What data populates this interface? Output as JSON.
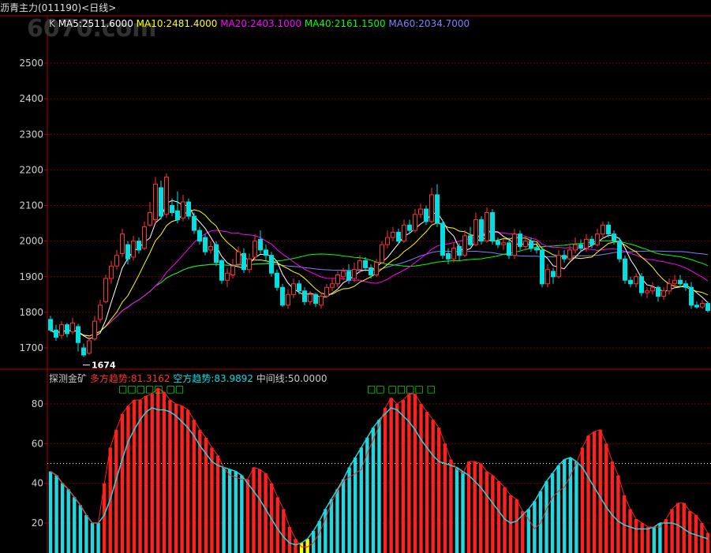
{
  "window": {
    "title": "沥青主力(011190)<日线>"
  },
  "watermark": {
    "text": "6070.com"
  },
  "price_panel": {
    "legend": [
      {
        "key": "k",
        "text": "K",
        "color": "#c8c8c8"
      },
      {
        "key": "ma5",
        "text": "MA5:2511.6000",
        "color": "#ffffff"
      },
      {
        "key": "ma10",
        "text": "MA10:2481.4000",
        "color": "#ffff00"
      },
      {
        "key": "ma20",
        "text": "MA20:2403.1000",
        "color": "#ff00ff"
      },
      {
        "key": "ma40",
        "text": "MA40:2161.1500",
        "color": "#00ff00"
      },
      {
        "key": "ma60",
        "text": "MA60:2034.7000",
        "color": "#8080ff"
      }
    ],
    "y_ticks": [
      "2500",
      "2400",
      "2300",
      "2200",
      "2100",
      "2000",
      "1900",
      "1800",
      "1700"
    ],
    "low_marker": "1674"
  },
  "indicator_panel": {
    "legend": [
      {
        "key": "name",
        "text": "探测金矿",
        "color": "#c8c8c8"
      },
      {
        "key": "bull",
        "text": "多方趋势:81.3162",
        "color": "#ff3030"
      },
      {
        "key": "bear",
        "text": "空方趋势:83.9892",
        "color": "#00e0e0"
      },
      {
        "key": "mid",
        "text": "中间线:50.0000",
        "color": "#c8c8c8"
      }
    ],
    "y_ticks": [
      "80",
      "60",
      "40",
      "20"
    ],
    "signals": [
      "□□□□□ □□",
      "□□ □□□□ □"
    ]
  },
  "colors": {
    "up": "#ff3232",
    "down": "#00e0e0",
    "grid": "#7a0000",
    "axis": "#b00000",
    "bull_bar": "#ff2020",
    "bear_bar": "#20d8e0",
    "yellow_bar": "#ffff00",
    "signal": "#00ff00"
  },
  "chart_data": [
    {
      "type": "candlestick",
      "title": "沥青主力(011190)<日线>",
      "ylim": [
        1660,
        2560
      ],
      "y_ticks": [
        2500,
        2400,
        2300,
        2200,
        2100,
        2000,
        1900,
        1800,
        1700
      ],
      "candles": [
        [
          1780,
          1750,
          1790,
          1745
        ],
        [
          1750,
          1730,
          1765,
          1720
        ],
        [
          1735,
          1765,
          1775,
          1725
        ],
        [
          1765,
          1740,
          1770,
          1730
        ],
        [
          1745,
          1770,
          1785,
          1738
        ],
        [
          1760,
          1715,
          1768,
          1690
        ],
        [
          1700,
          1680,
          1712,
          1674
        ],
        [
          1685,
          1720,
          1735,
          1680
        ],
        [
          1725,
          1775,
          1790,
          1720
        ],
        [
          1780,
          1820,
          1835,
          1770
        ],
        [
          1830,
          1895,
          1905,
          1825
        ],
        [
          1895,
          1930,
          1945,
          1880
        ],
        [
          1930,
          1960,
          1975,
          1920
        ],
        [
          1965,
          2020,
          2035,
          1955
        ],
        [
          1990,
          1950,
          2000,
          1935
        ],
        [
          1955,
          2000,
          2015,
          1945
        ],
        [
          2000,
          1975,
          2010,
          1965
        ],
        [
          1980,
          2040,
          2055,
          1975
        ],
        [
          2045,
          2080,
          2110,
          2040
        ],
        [
          2060,
          2160,
          2180,
          2050
        ],
        [
          2150,
          2070,
          2170,
          2060
        ],
        [
          2075,
          2180,
          2190,
          2065
        ],
        [
          2100,
          2080,
          2120,
          2070
        ],
        [
          2085,
          2060,
          2140,
          2050
        ],
        [
          2065,
          2110,
          2130,
          2055
        ],
        [
          2110,
          2070,
          2120,
          2060
        ],
        [
          2070,
          2030,
          2080,
          2020
        ],
        [
          2030,
          2000,
          2040,
          1990
        ],
        [
          2010,
          1970,
          2020,
          1960
        ],
        [
          1975,
          1985,
          2000,
          1965
        ],
        [
          1990,
          1940,
          2000,
          1930
        ],
        [
          1945,
          1890,
          1950,
          1880
        ],
        [
          1890,
          1910,
          1925,
          1870
        ],
        [
          1905,
          1930,
          1950,
          1895
        ],
        [
          1935,
          1970,
          1985,
          1925
        ],
        [
          1965,
          1920,
          1980,
          1910
        ],
        [
          1920,
          1950,
          1965,
          1910
        ],
        [
          1955,
          2000,
          2020,
          1945
        ],
        [
          2005,
          1975,
          2030,
          1965
        ],
        [
          1975,
          1960,
          1990,
          1945
        ],
        [
          1960,
          1910,
          1970,
          1900
        ],
        [
          1910,
          1870,
          1920,
          1860
        ],
        [
          1870,
          1820,
          1880,
          1815
        ],
        [
          1820,
          1850,
          1865,
          1810
        ],
        [
          1850,
          1880,
          1895,
          1840
        ],
        [
          1880,
          1860,
          1890,
          1850
        ],
        [
          1860,
          1830,
          1870,
          1820
        ],
        [
          1830,
          1850,
          1860,
          1820
        ],
        [
          1850,
          1825,
          1855,
          1815
        ],
        [
          1820,
          1845,
          1855,
          1810
        ],
        [
          1845,
          1870,
          1880,
          1840
        ],
        [
          1870,
          1880,
          1895,
          1860
        ],
        [
          1880,
          1905,
          1915,
          1870
        ],
        [
          1900,
          1915,
          1925,
          1890
        ],
        [
          1915,
          1890,
          1935,
          1880
        ],
        [
          1895,
          1920,
          1940,
          1885
        ],
        [
          1920,
          1945,
          1960,
          1910
        ],
        [
          1945,
          1925,
          1955,
          1915
        ],
        [
          1925,
          1905,
          1935,
          1895
        ],
        [
          1905,
          1940,
          1950,
          1900
        ],
        [
          1940,
          1990,
          2000,
          1935
        ],
        [
          1990,
          2010,
          2030,
          1980
        ],
        [
          2010,
          2025,
          2040,
          2000
        ],
        [
          2025,
          2000,
          2035,
          1990
        ],
        [
          2000,
          2045,
          2060,
          1995
        ],
        [
          2045,
          2030,
          2060,
          2020
        ],
        [
          2030,
          2075,
          2090,
          2025
        ],
        [
          2075,
          2090,
          2105,
          2065
        ],
        [
          2090,
          2055,
          2100,
          2045
        ],
        [
          2055,
          2130,
          2150,
          2050
        ],
        [
          2130,
          2050,
          2160,
          2040
        ],
        [
          2050,
          1960,
          2060,
          1950
        ],
        [
          1965,
          1950,
          1980,
          1935
        ],
        [
          1950,
          1980,
          1995,
          1940
        ],
        [
          1985,
          1960,
          1995,
          1945
        ],
        [
          1960,
          2015,
          2030,
          1955
        ],
        [
          2015,
          1990,
          2040,
          1985
        ],
        [
          1990,
          2060,
          2080,
          1985
        ],
        [
          2060,
          2000,
          2070,
          1990
        ],
        [
          2000,
          2080,
          2095,
          1995
        ],
        [
          2080,
          2000,
          2090,
          1990
        ],
        [
          2000,
          1990,
          2010,
          1980
        ],
        [
          1990,
          1995,
          2005,
          1975
        ],
        [
          1995,
          1960,
          2010,
          1950
        ],
        [
          1960,
          2020,
          2035,
          1950
        ],
        [
          2020,
          1985,
          2030,
          1975
        ],
        [
          1985,
          2000,
          2015,
          1975
        ],
        [
          2000,
          1980,
          2010,
          1970
        ],
        [
          1980,
          1975,
          1990,
          1965
        ],
        [
          1975,
          1880,
          1985,
          1870
        ],
        [
          1880,
          1920,
          1935,
          1870
        ],
        [
          1915,
          1900,
          1925,
          1880
        ],
        [
          1900,
          1960,
          1975,
          1895
        ],
        [
          1960,
          1950,
          1975,
          1940
        ],
        [
          1950,
          1975,
          1990,
          1945
        ],
        [
          1975,
          1990,
          2010,
          1965
        ],
        [
          1990,
          1980,
          2005,
          1970
        ],
        [
          1980,
          2005,
          2020,
          1970
        ],
        [
          2005,
          1990,
          2015,
          1980
        ],
        [
          1990,
          2020,
          2035,
          1985
        ],
        [
          2020,
          2045,
          2055,
          2010
        ],
        [
          2045,
          2020,
          2055,
          2010
        ],
        [
          2020,
          2000,
          2030,
          1990
        ],
        [
          2000,
          1950,
          2010,
          1940
        ],
        [
          1950,
          1890,
          1960,
          1880
        ],
        [
          1890,
          1880,
          1900,
          1870
        ],
        [
          1880,
          1900,
          1910,
          1870
        ],
        [
          1900,
          1855,
          1910,
          1845
        ],
        [
          1855,
          1860,
          1870,
          1840
        ],
        [
          1860,
          1870,
          1885,
          1850
        ],
        [
          1870,
          1845,
          1875,
          1830
        ],
        [
          1845,
          1860,
          1870,
          1835
        ],
        [
          1860,
          1880,
          1895,
          1850
        ],
        [
          1880,
          1890,
          1905,
          1870
        ],
        [
          1890,
          1880,
          1905,
          1870
        ],
        [
          1880,
          1870,
          1890,
          1860
        ],
        [
          1870,
          1820,
          1885,
          1810
        ],
        [
          1820,
          1815,
          1830,
          1810
        ],
        [
          1815,
          1825,
          1835,
          1810
        ],
        [
          1825,
          1805,
          1830,
          1800
        ]
      ]
    },
    {
      "type": "bar",
      "title": "探测金矿",
      "ylim": [
        10,
        96
      ],
      "y_ticks": [
        80,
        60,
        40,
        20
      ],
      "mid_line": 50,
      "bull_trend": [
        46,
        44,
        40,
        37,
        33,
        29,
        24,
        20,
        20,
        40,
        58,
        67,
        75,
        79,
        82,
        82,
        84,
        85,
        88,
        86,
        82,
        80,
        79,
        77,
        72,
        67,
        63,
        58,
        54,
        48,
        44,
        43,
        42,
        42,
        48,
        47,
        45,
        40,
        33,
        27,
        18,
        12,
        8,
        8,
        10,
        15,
        22,
        30,
        36,
        41,
        43,
        45,
        47,
        55,
        62,
        69,
        78,
        83,
        80,
        82,
        85,
        85,
        80,
        76,
        72,
        68,
        60,
        52,
        47,
        45,
        51,
        51,
        50,
        46,
        44,
        41,
        38,
        34,
        32,
        26,
        22,
        17,
        20,
        27,
        33,
        36,
        38,
        44,
        50,
        58,
        64,
        66,
        67,
        60,
        51,
        44,
        34,
        27,
        22,
        20,
        18,
        18,
        18,
        22,
        27,
        30,
        30,
        26,
        24,
        20,
        15
      ],
      "bear_trend": [
        46,
        44,
        40,
        37,
        33,
        29,
        24,
        20,
        20,
        24,
        32,
        42,
        52,
        61,
        67,
        72,
        76,
        78,
        77,
        77,
        76,
        74,
        71,
        68,
        64,
        59,
        55,
        51,
        49,
        48,
        47,
        46,
        44,
        40,
        36,
        32,
        27,
        22,
        17,
        13,
        10,
        9,
        10,
        12,
        16,
        21,
        27,
        32,
        37,
        42,
        48,
        53,
        58,
        63,
        68,
        72,
        75,
        78,
        77,
        74,
        71,
        67,
        62,
        58,
        54,
        51,
        50,
        49,
        48,
        46,
        44,
        41,
        38,
        34,
        30,
        26,
        22,
        20,
        21,
        24,
        27,
        31,
        36,
        41,
        45,
        49,
        52,
        53,
        51,
        48,
        43,
        38,
        33,
        28,
        24,
        21,
        19,
        18,
        17,
        17,
        17,
        18,
        20,
        20,
        20,
        19,
        17,
        15,
        14,
        13,
        12
      ],
      "yellow_bars": [
        42,
        43
      ]
    }
  ]
}
